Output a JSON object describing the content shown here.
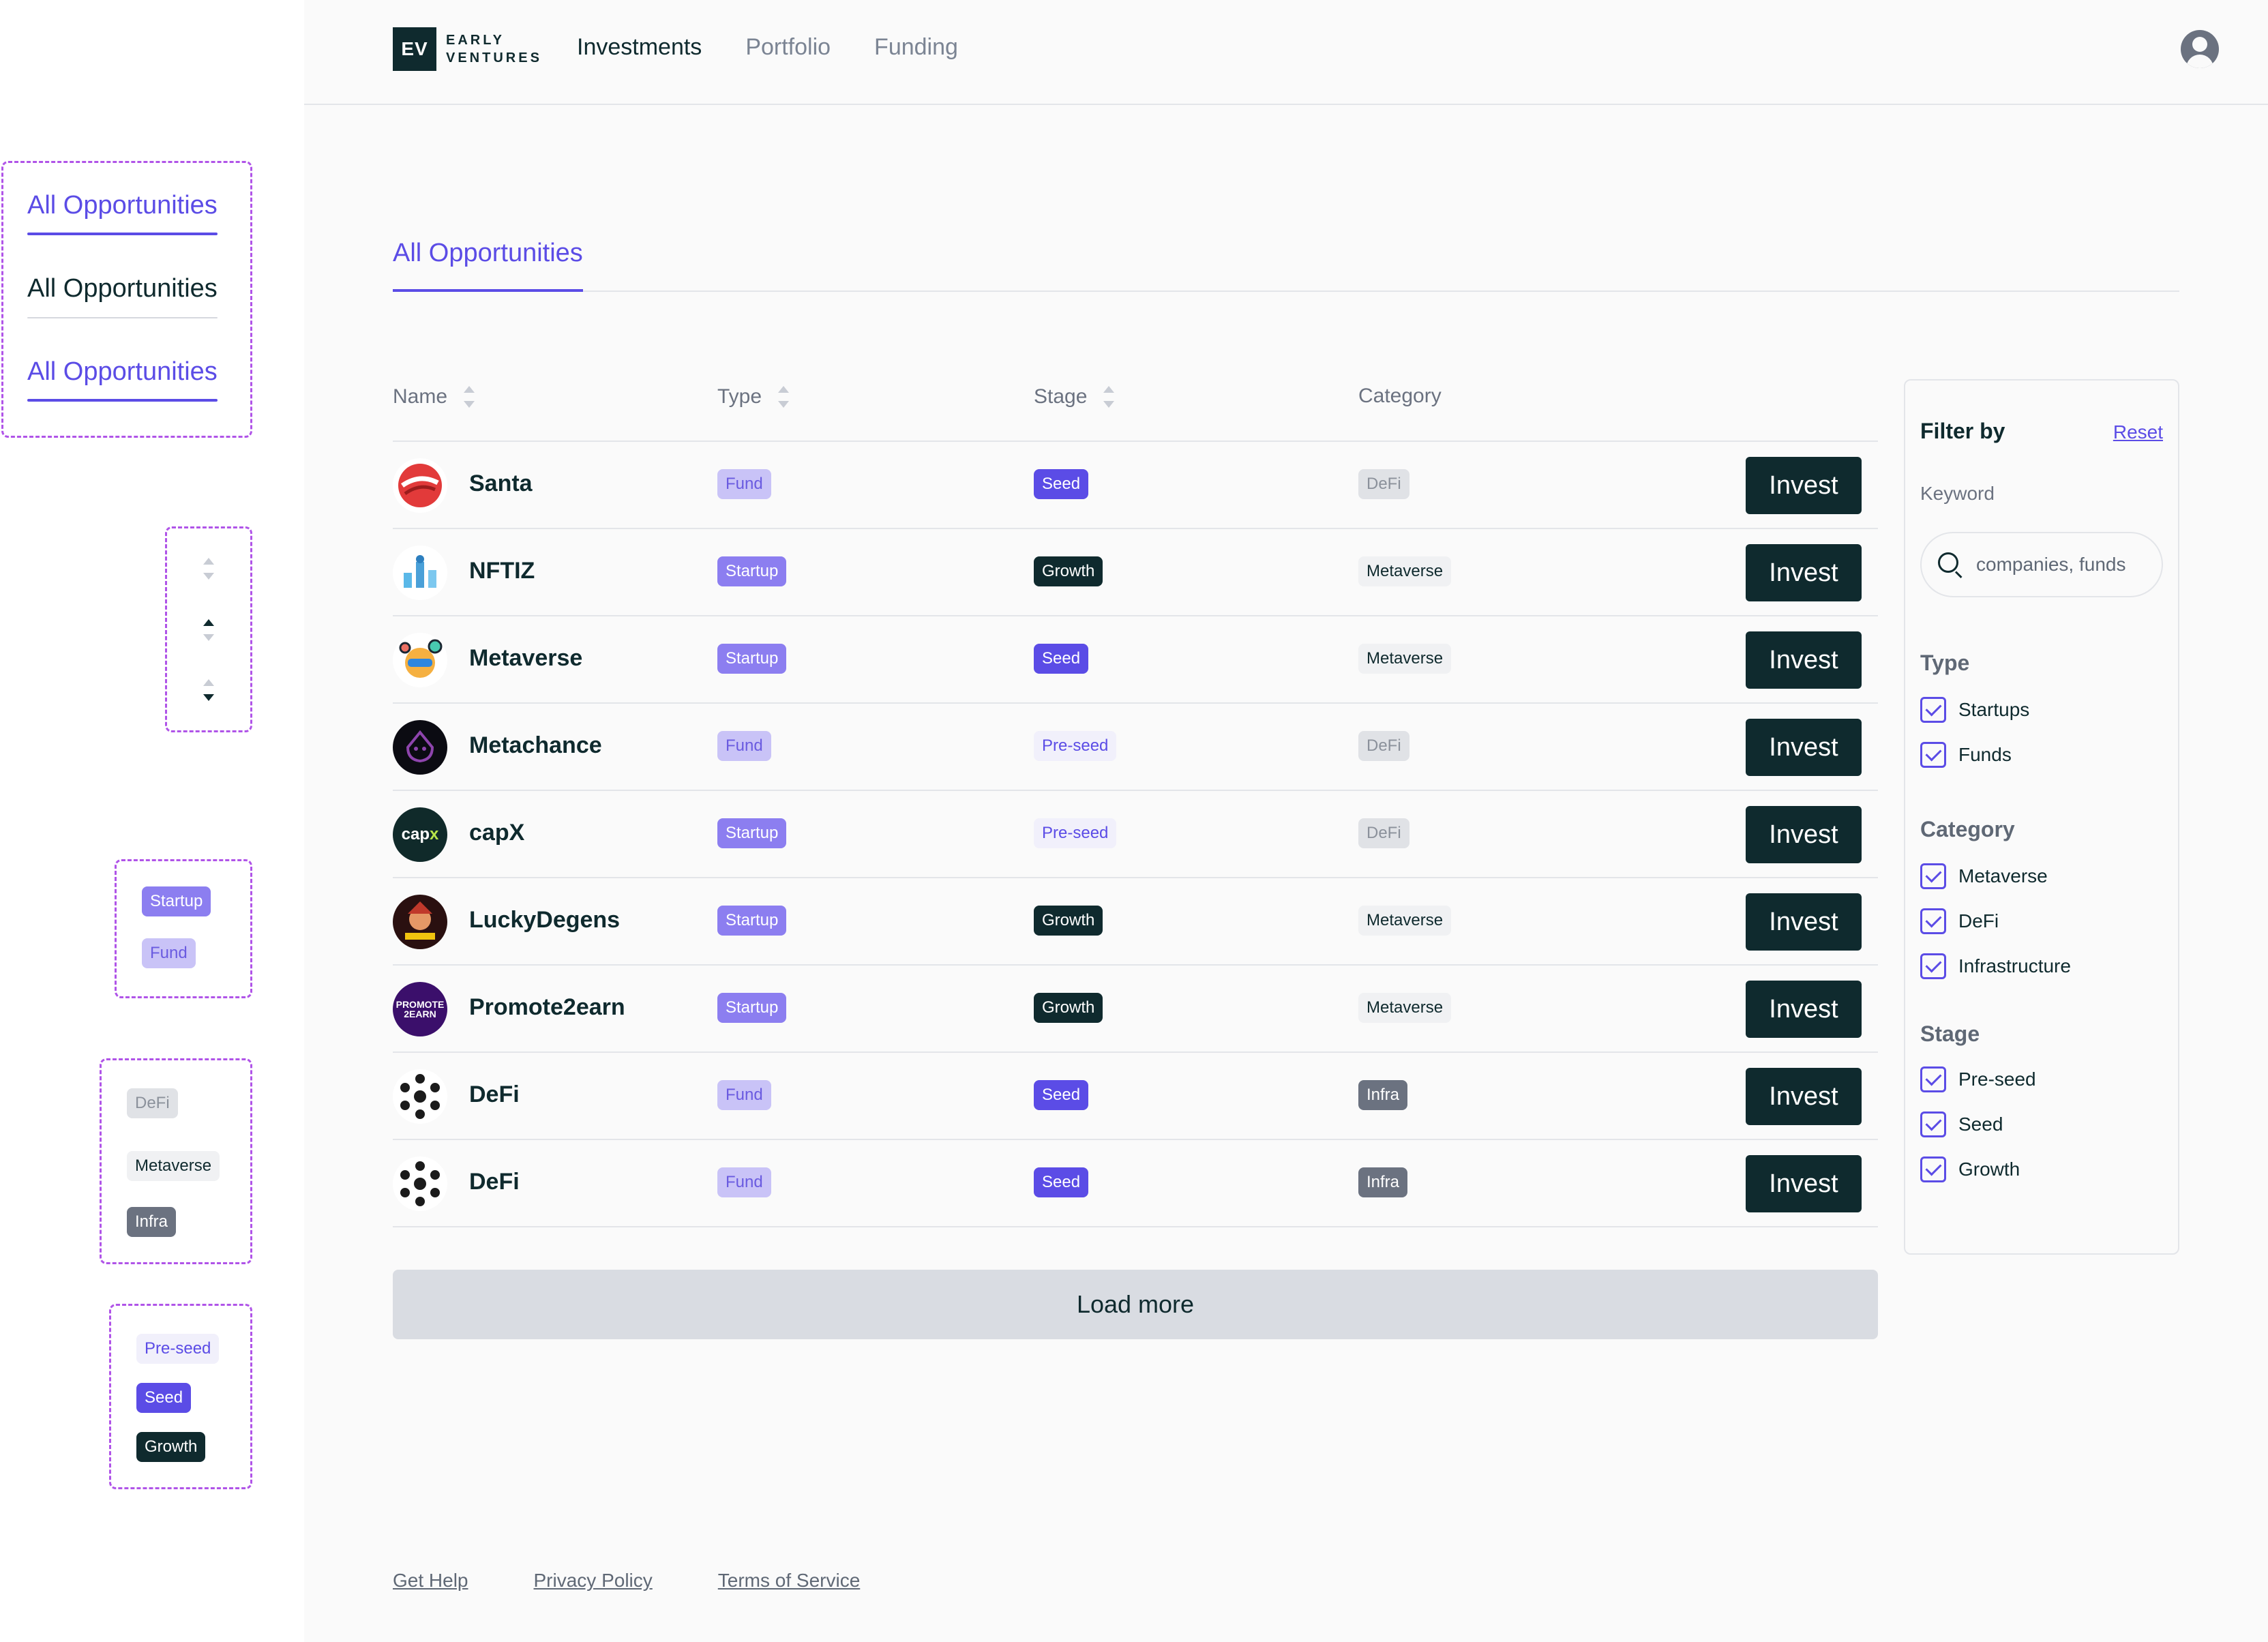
{
  "sheet": {
    "tab_variants": [
      "All Opportunities",
      "All Opportunities",
      "All Opportunities"
    ],
    "type_badges": [
      "Startup",
      "Fund"
    ],
    "category_badges": [
      "DeFi",
      "Metaverse",
      "Infra"
    ],
    "stage_badges": [
      "Pre-seed",
      "Seed",
      "Growth"
    ]
  },
  "brand": {
    "mark": "EV",
    "line1": "EARLY",
    "line2": "VENTURES"
  },
  "nav": [
    "Investments",
    "Portfolio",
    "Funding"
  ],
  "tabs": {
    "active": "All Opportunities"
  },
  "table": {
    "headers": {
      "name": "Name",
      "type": "Type",
      "stage": "Stage",
      "category": "Category"
    },
    "invest_label": "Invest",
    "rows": [
      {
        "name": "Santa",
        "type": "Fund",
        "stage": "Seed",
        "category": "DeFi",
        "logo": "santa-logo"
      },
      {
        "name": "NFTIZ",
        "type": "Startup",
        "stage": "Growth",
        "category": "Metaverse",
        "logo": "nftiz-logo"
      },
      {
        "name": "Metaverse",
        "type": "Startup",
        "stage": "Seed",
        "category": "Metaverse",
        "logo": "metaverse-logo"
      },
      {
        "name": "Metachance",
        "type": "Fund",
        "stage": "Pre-seed",
        "category": "DeFi",
        "logo": "metachance-logo"
      },
      {
        "name": "capX",
        "type": "Startup",
        "stage": "Pre-seed",
        "category": "DeFi",
        "logo": "capx-logo"
      },
      {
        "name": "LuckyDegens",
        "type": "Startup",
        "stage": "Growth",
        "category": "Metaverse",
        "logo": "luckydegens-logo"
      },
      {
        "name": "Promote2earn",
        "type": "Startup",
        "stage": "Growth",
        "category": "Metaverse",
        "logo": "promote2earn-logo"
      },
      {
        "name": "DeFi",
        "type": "Fund",
        "stage": "Seed",
        "category": "Infra",
        "logo": "defi-logo"
      },
      {
        "name": "DeFi",
        "type": "Fund",
        "stage": "Seed",
        "category": "Infra",
        "logo": "defi-logo"
      }
    ]
  },
  "load_more": "Load more",
  "filter": {
    "title": "Filter by",
    "reset": "Reset",
    "keyword_label": "Keyword",
    "search_placeholder": "companies, funds",
    "groups": [
      {
        "label": "Type",
        "options": [
          "Startups",
          "Funds"
        ]
      },
      {
        "label": "Category",
        "options": [
          "Metaverse",
          "DeFi",
          "Infrastructure"
        ]
      },
      {
        "label": "Stage",
        "options": [
          "Pre-seed",
          "Seed",
          "Growth"
        ]
      }
    ]
  },
  "footer": [
    "Get Help",
    "Privacy Policy",
    "Terms of Service"
  ],
  "colors": {
    "accent": "#5b4ce6",
    "dark": "#0f2a2e",
    "dashed_outline": "#b054e8"
  }
}
